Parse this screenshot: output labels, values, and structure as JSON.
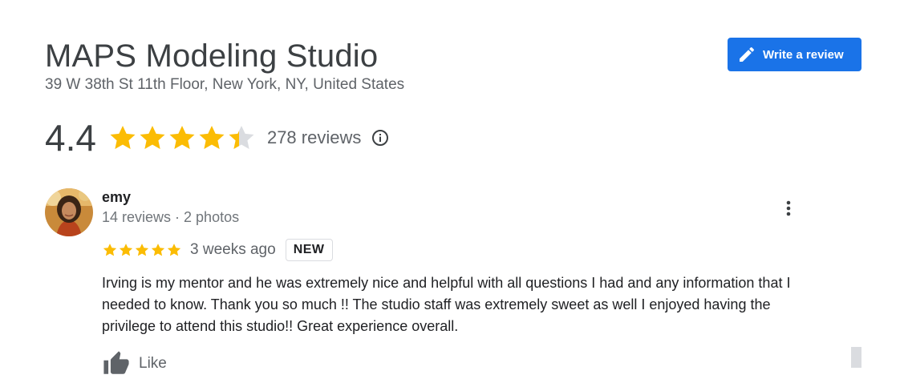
{
  "place": {
    "name": "MAPS Modeling Studio",
    "address": "39 W 38th St 11th Floor, New York, NY, United States"
  },
  "actions": {
    "write_review_label": "Write a review"
  },
  "summary": {
    "rating": "4.4",
    "rating_value": 4.4,
    "reviews_label": "278 reviews",
    "star_color": "#fbbc04",
    "star_empty_color": "#dadce0"
  },
  "review": {
    "author": "emy",
    "author_meta": "14 reviews · 2 photos",
    "stars": 5,
    "date": "3 weeks ago",
    "badge": "NEW",
    "text": "Irving is my mentor and he was extremely nice and helpful with all questions I had and any information that I needed to know. Thank you so much !! The studio staff was extremely sweet as well I enjoyed having the privilege to attend this studio!! Great experience overall.",
    "like_label": "Like"
  },
  "colors": {
    "accent": "#1a73e8"
  }
}
